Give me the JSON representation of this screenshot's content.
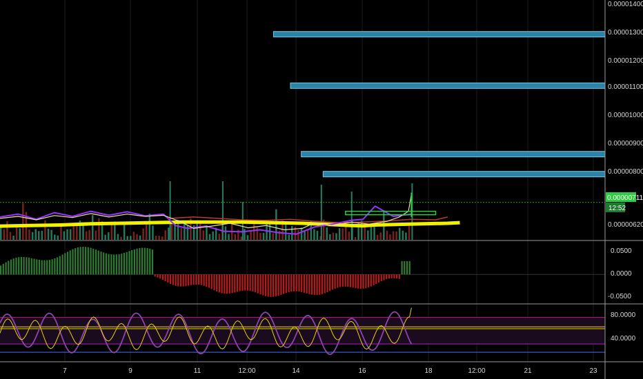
{
  "chart_data": {
    "type": "line",
    "colors": {
      "background": "#000000",
      "grid": "#1c1c1c",
      "axis": "#9a9a9a",
      "zone": "#2a84a8",
      "zone_border": "#7fc6e6",
      "ma_slow": "#f2f200",
      "price": "#eadfa8",
      "indicator_purple": "#9933ff",
      "indicator_red": "#c0392b",
      "bull": "#2e8b6e",
      "bear": "#8b2a22",
      "green": "#2ecc40",
      "hist_up": "#2e7d32",
      "hist_down": "#b71c1c",
      "rsi": "#e8d400",
      "stoch": "#8e44ad"
    },
    "x_ticks": [
      "7",
      "9",
      "11",
      "12:00",
      "14",
      "16",
      "18",
      "12:00",
      "21",
      "23"
    ],
    "price_pane": {
      "y_ticks": [
        "0.00001400",
        "0.00001300",
        "0.00001200",
        "0.00001100",
        "0.00001000",
        "0.00000900",
        "0.00000800",
        "0.00000620"
      ],
      "ylim": [
        5.8e-06,
        1.42e-05
      ],
      "last_price": "0.00000711",
      "last_price_value": 7.11e-06,
      "countdown": "12:52",
      "zones": [
        {
          "from_x": 0.452,
          "price": 1.3e-05
        },
        {
          "from_x": 0.48,
          "price": 1.12e-05
        },
        {
          "from_x": 0.498,
          "price": 8.8e-06
        },
        {
          "from_x": 0.534,
          "price": 8.1e-06
        }
      ],
      "ma_slow": [
        [
          0.0,
          6.28
        ],
        [
          0.05,
          6.3
        ],
        [
          0.1,
          6.32
        ],
        [
          0.15,
          6.36
        ],
        [
          0.2,
          6.38
        ],
        [
          0.25,
          6.4
        ],
        [
          0.3,
          6.42
        ],
        [
          0.35,
          6.42
        ],
        [
          0.4,
          6.42
        ],
        [
          0.45,
          6.4
        ],
        [
          0.5,
          6.38
        ],
        [
          0.55,
          6.33
        ],
        [
          0.58,
          6.3
        ],
        [
          0.6,
          6.29
        ],
        [
          0.62,
          6.32
        ],
        [
          0.66,
          6.34
        ],
        [
          0.7,
          6.36
        ],
        [
          0.74,
          6.38
        ],
        [
          0.76,
          6.4
        ]
      ],
      "price_line": [
        [
          0.0,
          6.55
        ],
        [
          0.03,
          6.62
        ],
        [
          0.06,
          6.5
        ],
        [
          0.09,
          6.65
        ],
        [
          0.12,
          6.58
        ],
        [
          0.15,
          6.72
        ],
        [
          0.18,
          6.6
        ],
        [
          0.21,
          6.7
        ],
        [
          0.24,
          6.62
        ],
        [
          0.27,
          6.66
        ],
        [
          0.3,
          6.42
        ],
        [
          0.32,
          6.2
        ],
        [
          0.35,
          6.28
        ],
        [
          0.38,
          6.38
        ],
        [
          0.41,
          6.22
        ],
        [
          0.44,
          6.3
        ],
        [
          0.47,
          6.15
        ],
        [
          0.5,
          6.2
        ],
        [
          0.52,
          6.4
        ],
        [
          0.55,
          6.3
        ],
        [
          0.58,
          6.42
        ],
        [
          0.61,
          6.35
        ],
        [
          0.64,
          6.45
        ],
        [
          0.66,
          6.6
        ],
        [
          0.675,
          6.8
        ],
        [
          0.68,
          7.4
        ]
      ],
      "purple_line": [
        [
          0.0,
          6.6
        ],
        [
          0.03,
          6.7
        ],
        [
          0.06,
          6.52
        ],
        [
          0.09,
          6.75
        ],
        [
          0.12,
          6.62
        ],
        [
          0.15,
          6.8
        ],
        [
          0.18,
          6.66
        ],
        [
          0.21,
          6.78
        ],
        [
          0.24,
          6.64
        ],
        [
          0.27,
          6.7
        ],
        [
          0.29,
          6.3
        ],
        [
          0.31,
          6.2
        ],
        [
          0.34,
          6.28
        ],
        [
          0.37,
          6.1
        ],
        [
          0.4,
          6.08
        ],
        [
          0.43,
          6.15
        ],
        [
          0.46,
          6.05
        ],
        [
          0.49,
          6.0
        ],
        [
          0.52,
          6.25
        ],
        [
          0.55,
          6.35
        ],
        [
          0.58,
          6.48
        ],
        [
          0.6,
          6.52
        ],
        [
          0.62,
          6.98
        ],
        [
          0.65,
          6.62
        ],
        [
          0.68,
          6.7
        ]
      ],
      "red_line": [
        [
          0.28,
          6.55
        ],
        [
          0.32,
          6.6
        ],
        [
          0.36,
          6.55
        ],
        [
          0.4,
          6.5
        ],
        [
          0.44,
          6.48
        ],
        [
          0.48,
          6.52
        ],
        [
          0.52,
          6.45
        ],
        [
          0.56,
          6.4
        ],
        [
          0.6,
          6.42
        ],
        [
          0.64,
          6.46
        ],
        [
          0.68,
          6.52
        ],
        [
          0.72,
          6.5
        ],
        [
          0.74,
          6.6
        ]
      ],
      "green_box": {
        "x0": 0.571,
        "x1": 0.72,
        "price": 6.8
      },
      "candles_count": 130
    },
    "macd_pane": {
      "y_ticks": [
        "0.0500",
        "0.0000",
        "-0.0500"
      ],
      "ylim": [
        -0.065,
        0.075
      ]
    },
    "rsi_pane": {
      "y_ticks": [
        "80.0000",
        "40.0000"
      ],
      "ylim": [
        10,
        100
      ],
      "levels": [
        80,
        65,
        62,
        38,
        25
      ]
    }
  }
}
